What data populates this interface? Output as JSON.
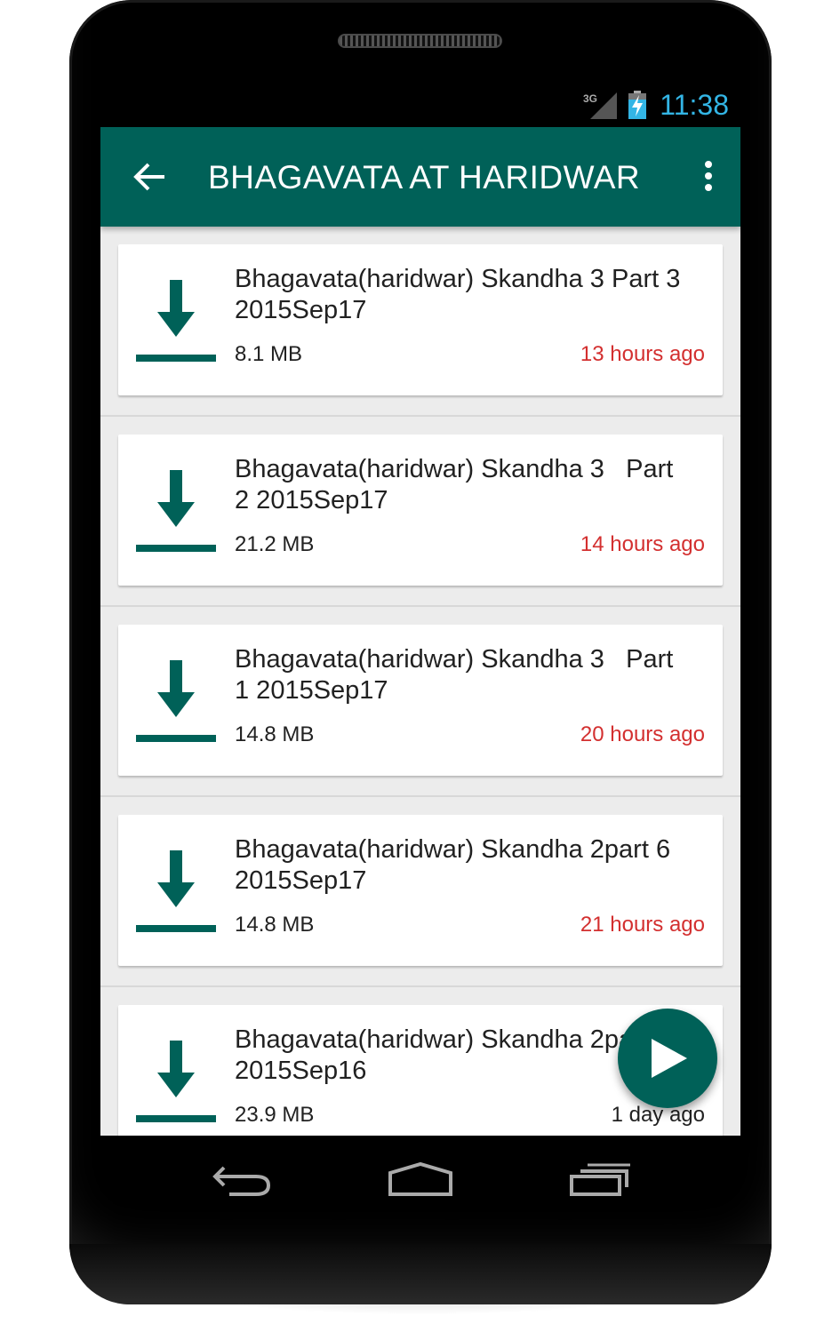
{
  "status_bar": {
    "network_label": "3G",
    "time": "11:38"
  },
  "app_bar": {
    "title": "BHAGAVATA AT HARIDWAR",
    "back_icon": "arrow-left-icon",
    "menu_icon": "more-vert-icon"
  },
  "colors": {
    "primary": "#006158",
    "time_text": "#d32f2f",
    "status_clock": "#33b5e5",
    "list_background": "#ececec"
  },
  "items": [
    {
      "title": "Bhagavata(haridwar) Skandha 3 Part 3\n2015Sep17",
      "size": "8.1 MB",
      "time": "13 hours ago",
      "time_color": "#d32f2f"
    },
    {
      "title": "Bhagavata(haridwar) Skandha 3   Part\n2 2015Sep17",
      "size": "21.2 MB",
      "time": "14 hours ago",
      "time_color": "#d32f2f"
    },
    {
      "title": "Bhagavata(haridwar) Skandha 3   Part\n1 2015Sep17",
      "size": "14.8 MB",
      "time": "20 hours ago",
      "time_color": "#d32f2f"
    },
    {
      "title": "Bhagavata(haridwar) Skandha 2part 6\n2015Sep17",
      "size": "14.8 MB",
      "time": "21 hours ago",
      "time_color": "#d32f2f"
    },
    {
      "title": "Bhagavata(haridwar) Skandha 2part 5\n2015Sep16",
      "size": "23.9 MB",
      "time": "1 day ago",
      "time_color": "#212121"
    }
  ],
  "fab": {
    "icon": "play-icon"
  },
  "nav": {
    "back_icon": "nav-back-icon",
    "home_icon": "nav-home-icon",
    "recents_icon": "nav-recents-icon"
  }
}
